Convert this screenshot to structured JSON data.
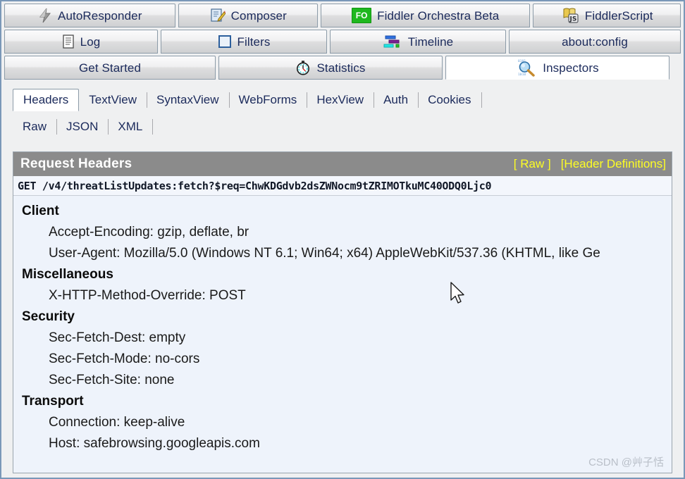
{
  "window": {
    "frame_color": "#7a98b8",
    "background": "#eff0f1"
  },
  "top_tabs": {
    "row1": [
      {
        "label": "AutoResponder",
        "icon": "lightning-icon",
        "selected": false
      },
      {
        "label": "Composer",
        "icon": "composer-pencil-icon",
        "selected": false
      },
      {
        "label": "Fiddler Orchestra Beta",
        "icon": "fiddler-orchestra-icon",
        "icon_text": "FO",
        "selected": false
      },
      {
        "label": "FiddlerScript",
        "icon": "script-js-icon",
        "icon_text": "JS",
        "selected": false
      }
    ],
    "row2": [
      {
        "label": "Log",
        "icon": "log-document-icon",
        "selected": false
      },
      {
        "label": "Filters",
        "icon": "filters-square-icon",
        "selected": false
      },
      {
        "label": "Timeline",
        "icon": "timeline-bars-icon",
        "selected": false
      },
      {
        "label": "about:config",
        "icon": "none",
        "selected": false
      }
    ],
    "row3": [
      {
        "label": "Get Started",
        "icon": "none",
        "selected": false
      },
      {
        "label": "Statistics",
        "icon": "stopwatch-icon",
        "selected": false
      },
      {
        "label": "Inspectors",
        "icon": "magnifier-inspect-icon",
        "selected": true
      }
    ]
  },
  "inspector_tabs": {
    "row1": [
      {
        "label": "Headers",
        "selected": true
      },
      {
        "label": "TextView",
        "selected": false
      },
      {
        "label": "SyntaxView",
        "selected": false
      },
      {
        "label": "WebForms",
        "selected": false
      },
      {
        "label": "HexView",
        "selected": false
      },
      {
        "label": "Auth",
        "selected": false
      },
      {
        "label": "Cookies",
        "selected": false
      }
    ],
    "row2": [
      {
        "label": "Raw",
        "selected": false
      },
      {
        "label": "JSON",
        "selected": false
      },
      {
        "label": "XML",
        "selected": false
      }
    ]
  },
  "headers_panel": {
    "title": "Request Headers",
    "title_bar_color": "#8b8b8b",
    "link_color": "#fdfd24",
    "actions": [
      {
        "label": "[ Raw ]"
      },
      {
        "label": "[Header Definitions]"
      }
    ],
    "request_line": "GET /v4/threatListUpdates:fetch?$req=ChwKDGdvb2dsZWNocm9tZRIMOTkuMC40ODQ0Ljc0",
    "groups": [
      {
        "name": "Client",
        "items": [
          "Accept-Encoding: gzip, deflate, br",
          "User-Agent: Mozilla/5.0 (Windows NT 6.1; Win64; x64) AppleWebKit/537.36 (KHTML, like Ge"
        ]
      },
      {
        "name": "Miscellaneous",
        "items": [
          "X-HTTP-Method-Override: POST"
        ]
      },
      {
        "name": "Security",
        "items": [
          "Sec-Fetch-Dest: empty",
          "Sec-Fetch-Mode: no-cors",
          "Sec-Fetch-Site: none"
        ]
      },
      {
        "name": "Transport",
        "items": [
          "Connection: keep-alive",
          "Host: safebrowsing.googleapis.com"
        ]
      }
    ]
  },
  "watermark": {
    "text": "CSDN @艸子恬"
  }
}
